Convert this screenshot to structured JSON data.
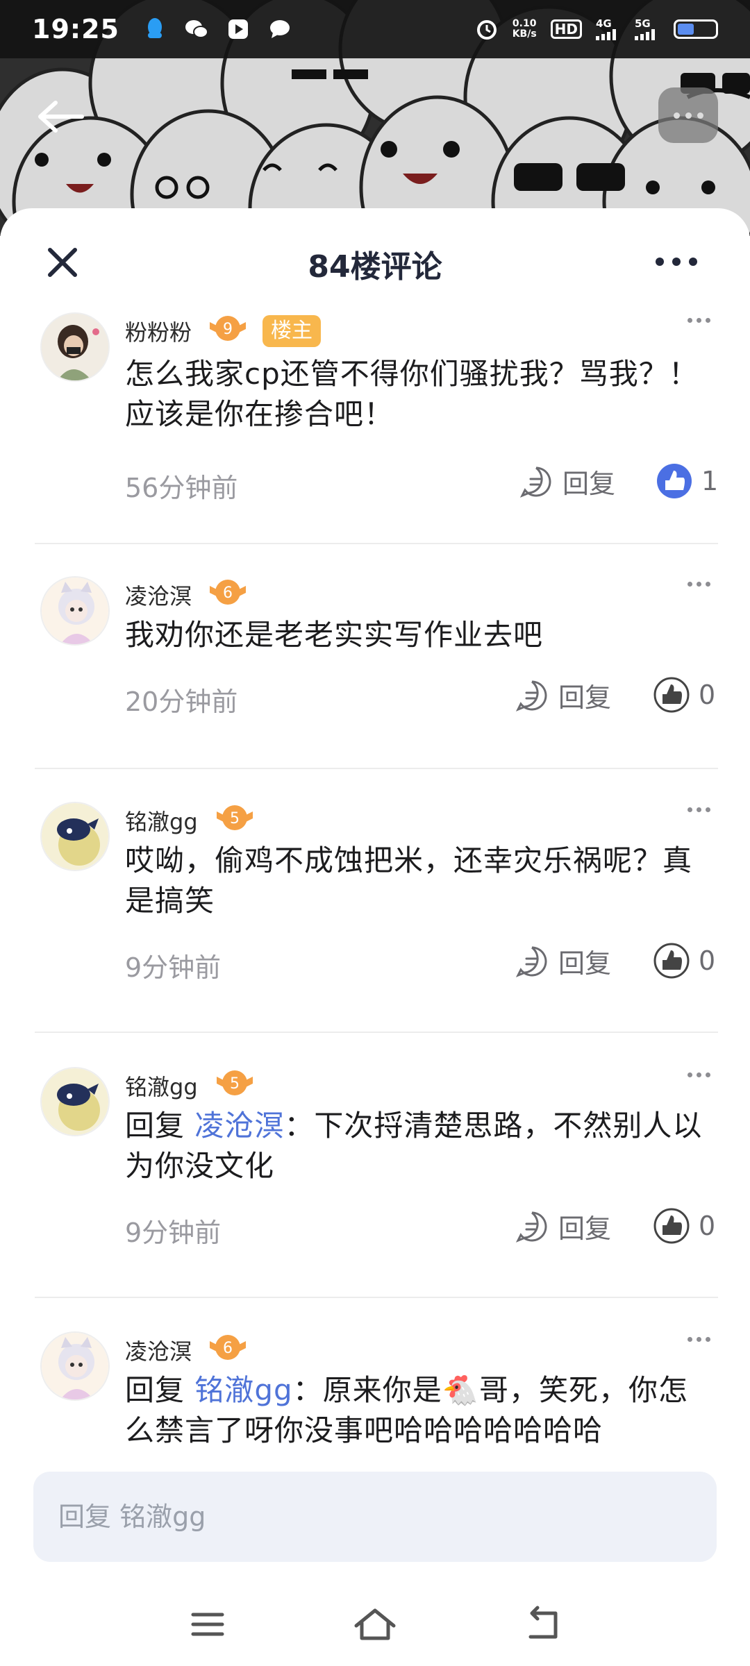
{
  "status_bar": {
    "time": "19:25",
    "speed_value": "0.10",
    "speed_unit": "KB/s",
    "hd_label": "HD",
    "sim1": "1",
    "sim2": "2",
    "net1": "4G",
    "net2": "5G",
    "battery_level": 0.45
  },
  "sheet": {
    "title": "84楼评论"
  },
  "comments": [
    {
      "username": "粉粉粉",
      "level": "9",
      "owner_tag": "楼主",
      "text": "怎么我家cp还管不得你们骚扰我？骂我？！ 应该是你在掺合吧！",
      "time": "56分钟前",
      "reply_label": "回复",
      "likes": "1",
      "liked": true
    },
    {
      "username": "凌沧溟",
      "level": "6",
      "text": "我劝你还是老老实实写作业去吧",
      "time": "20分钟前",
      "reply_label": "回复",
      "likes": "0"
    },
    {
      "username": "铭澈gg",
      "level": "5",
      "text": "哎呦，偷鸡不成蚀把米，还幸灾乐祸呢？真是搞笑",
      "time": "9分钟前",
      "reply_label": "回复",
      "likes": "0"
    },
    {
      "username": "铭澈gg",
      "level": "5",
      "reply_prefix": "回复 ",
      "mention": "凌沧溟",
      "text": "：下次捋清楚思路，不然别人以为你没文化",
      "time": "9分钟前",
      "reply_label": "回复",
      "likes": "0"
    },
    {
      "username": "凌沧溟",
      "level": "6",
      "reply_prefix": "回复 ",
      "mention": "铭澈gg",
      "text": "：原来你是🐔哥，笑死，你怎么禁言了呀你没事吧哈哈哈哈哈哈哈",
      "time": "",
      "reply_label": "回复",
      "likes": "0"
    }
  ],
  "input": {
    "placeholder": "回复 铭澈gg"
  },
  "colors": {
    "accent": "#4f73d8",
    "badge_orange": "#f5a044",
    "owner_tag": "#f8b74d",
    "input_bg": "#eef1f8"
  },
  "icons": [
    "qq-icon",
    "wechat-icon",
    "video-icon",
    "message-icon",
    "alarm-icon",
    "back-arrow-icon",
    "more-icon",
    "close-icon",
    "reply-icon",
    "like-icon",
    "menu-icon",
    "home-icon",
    "return-icon"
  ]
}
